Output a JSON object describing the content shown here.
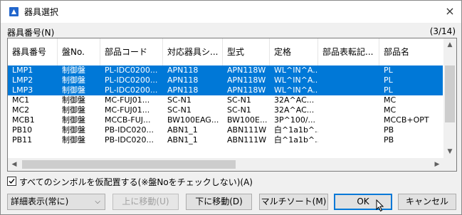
{
  "window": {
    "title": "器具選択",
    "close_label": "×"
  },
  "section": {
    "label": "器具番号(N)",
    "count": "(3/14)"
  },
  "list": {
    "columns": [
      "器具番号",
      "盤No.",
      "部品コード",
      "対応器具シ...",
      "型式",
      "定格",
      "部品表転記...",
      "部品名"
    ],
    "rows": [
      {
        "selected": true,
        "cells": [
          "LMP1",
          "制御盤",
          "PL-IDC0200...",
          "APN118",
          "APN118W",
          "WL^IN^A...",
          "",
          "PL"
        ]
      },
      {
        "selected": true,
        "cells": [
          "LMP2",
          "制御盤",
          "PL-IDC0200...",
          "APN118",
          "APN118W",
          "WL^IN^A...",
          "",
          "PL"
        ]
      },
      {
        "selected": true,
        "cells": [
          "LMP3",
          "制御盤",
          "PL-IDC0200...",
          "APN118",
          "APN118W",
          "WL^IN^A...",
          "",
          "PL"
        ]
      },
      {
        "selected": false,
        "cells": [
          "MC1",
          "制御盤",
          "MC-FUJ01...",
          "SC-N1",
          "SC-N1",
          "32A^AC...",
          "",
          "MC"
        ]
      },
      {
        "selected": false,
        "cells": [
          "MC2",
          "制御盤",
          "MC-FUJ01...",
          "SC-N1",
          "SC-N1",
          "32A^AC...",
          "",
          "MC"
        ]
      },
      {
        "selected": false,
        "cells": [
          "MCB1",
          "制御盤",
          "MCCB-FUJ...",
          "BW100EAG...",
          "BW100E...",
          "3P^100/...",
          "",
          "MCCB+OPT"
        ]
      },
      {
        "selected": false,
        "cells": [
          "PB10",
          "制御盤",
          "PB-IDC020...",
          "ABN1_1",
          "ABN111W",
          "白^1a1b^...",
          "",
          "PB"
        ]
      },
      {
        "selected": false,
        "cells": [
          "PB11",
          "制御盤",
          "PB-IDC020...",
          "ABN1_1",
          "ABN111W",
          "白^1a1b^...",
          "",
          "PB"
        ]
      }
    ]
  },
  "checkbox": {
    "checked": true,
    "label": "すべてのシンボルを仮配置する(※盤Noをチェックしない)(A)"
  },
  "footer": {
    "view_select_value": "詳細表示(常に)",
    "move_up_label": "上に移動(U)",
    "move_down_label": "下に移動(D)",
    "multisort_label": "マルチソート(M)",
    "ok_label": "OK",
    "cancel_label": "キャンセル"
  },
  "colors": {
    "selection": "#0078d7",
    "accent": "#0078d7"
  }
}
